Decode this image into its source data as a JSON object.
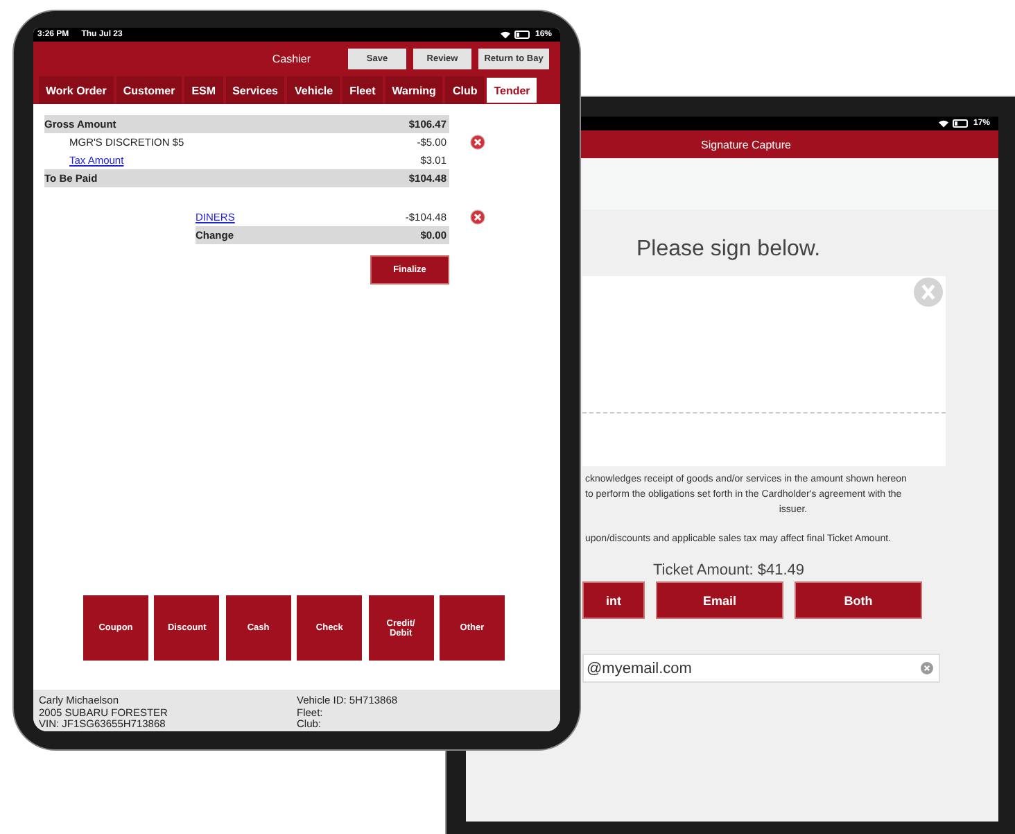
{
  "cashier_tablet": {
    "status_bar": {
      "time": "3:26 PM",
      "date": "Thu Jul 23",
      "battery": "16%"
    },
    "header": {
      "title": "Cashier",
      "buttons": [
        "Save",
        "Review",
        "Return to Bay"
      ]
    },
    "tabs": [
      {
        "label": "Work Order",
        "selected": false
      },
      {
        "label": "Customer",
        "selected": false
      },
      {
        "label": "ESM",
        "selected": false
      },
      {
        "label": "Services",
        "selected": false
      },
      {
        "label": "Vehicle",
        "selected": false
      },
      {
        "label": "Fleet",
        "selected": false
      },
      {
        "label": "Warning",
        "selected": false
      },
      {
        "label": "Club",
        "selected": false
      },
      {
        "label": "Tender",
        "selected": true
      }
    ],
    "totals": [
      {
        "kind": "total",
        "label": "Gross Amount",
        "amount": "$106.47",
        "link": false,
        "removable": false
      },
      {
        "kind": "line",
        "label": "MGR'S DISCRETION $5",
        "amount": "-$5.00",
        "link": false,
        "removable": true
      },
      {
        "kind": "line",
        "label": "Tax Amount",
        "amount": "$3.01",
        "link": true,
        "removable": false
      },
      {
        "kind": "total",
        "label": "To Be Paid",
        "amount": "$104.48",
        "link": false,
        "removable": false
      }
    ],
    "payments": [
      {
        "kind": "line",
        "label": "DINERS",
        "amount": "-$104.48",
        "link": true,
        "removable": true
      },
      {
        "kind": "total",
        "label": "Change",
        "amount": "$0.00",
        "link": false,
        "removable": false
      }
    ],
    "finalize_button": "Finalize",
    "tender_buttons": [
      "Coupon",
      "Discount",
      "Cash",
      "Check",
      "Credit/ Debit",
      "Other"
    ],
    "customer": [
      "Carly Michaelson",
      "2005 SUBARU FORESTER",
      "VIN: JF1SG63655H713868"
    ],
    "vehicle": [
      "Vehicle ID: 5H713868",
      "Fleet:",
      "Club:"
    ]
  },
  "signature_tablet": {
    "status_bar": {
      "battery": "17%"
    },
    "header": {
      "title": "Signature Capture"
    },
    "prompt": "Please sign below.",
    "disclaimer": [
      "cknowledges receipt of goods and/or services in the amount shown hereon",
      "to perform the obligations set forth in the Cardholder's agreement with the",
      "issuer."
    ],
    "note": "upon/discounts and applicable sales tax may affect final Ticket Amount.",
    "ticket_amount": "Ticket Amount: $41.49",
    "buttons": [
      "int",
      "Email",
      "Both"
    ],
    "email_field": {
      "value": "@myemail.com"
    }
  }
}
